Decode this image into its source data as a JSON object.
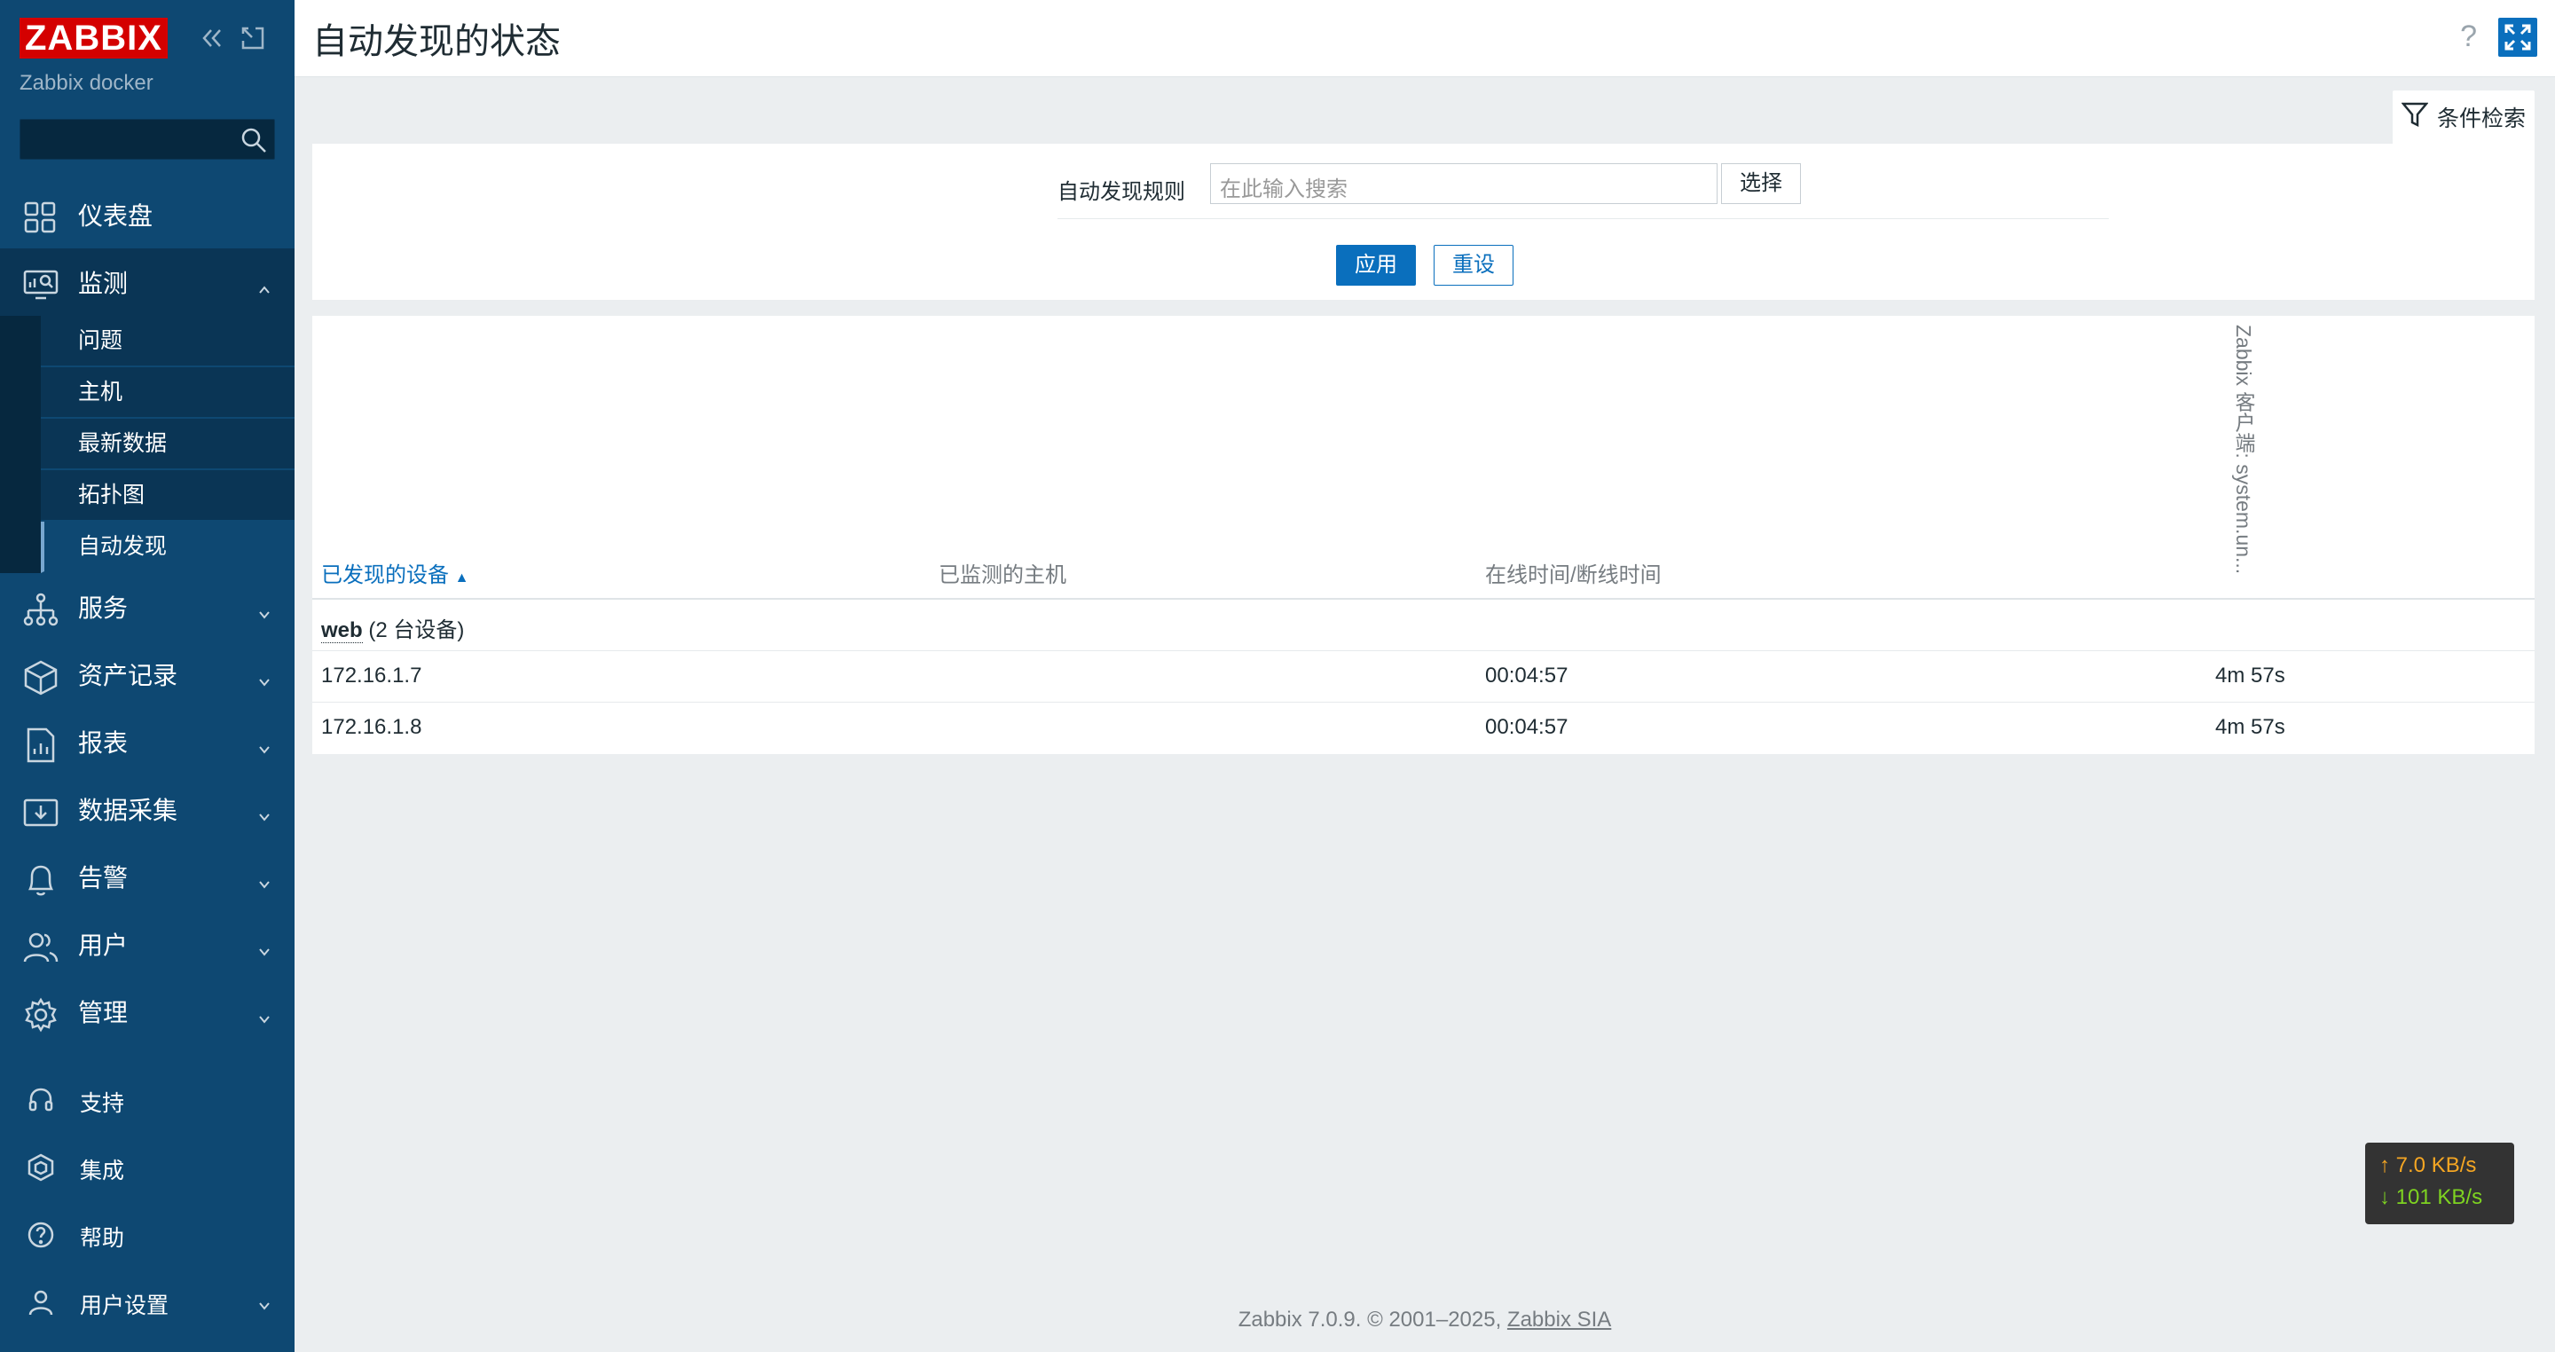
{
  "sidebar": {
    "logo": "ZABBIX",
    "server_name": "Zabbix docker",
    "search_placeholder": "",
    "menu": [
      {
        "label": "仪表盘",
        "icon": "dashboard-icon"
      },
      {
        "label": "监测",
        "icon": "monitoring-icon",
        "expanded": true,
        "children": [
          "问题",
          "主机",
          "最新数据",
          "拓扑图",
          "自动发现"
        ]
      },
      {
        "label": "服务",
        "icon": "services-icon"
      },
      {
        "label": "资产记录",
        "icon": "inventory-icon"
      },
      {
        "label": "报表",
        "icon": "reports-icon"
      },
      {
        "label": "数据采集",
        "icon": "data-collection-icon"
      },
      {
        "label": "告警",
        "icon": "alerts-icon"
      },
      {
        "label": "用户",
        "icon": "users-icon"
      },
      {
        "label": "管理",
        "icon": "administration-icon"
      }
    ],
    "bottom": [
      {
        "label": "支持",
        "icon": "support-icon"
      },
      {
        "label": "集成",
        "icon": "integrations-icon"
      },
      {
        "label": "帮助",
        "icon": "help-icon"
      },
      {
        "label": "用户设置",
        "icon": "user-settings-icon"
      }
    ]
  },
  "header": {
    "title": "自动发现的状态",
    "help": "?"
  },
  "filter": {
    "tab_label": "条件检索",
    "rule_label": "自动发现规则",
    "rule_placeholder": "在此输入搜索",
    "select_label": "选择",
    "apply_label": "应用",
    "reset_label": "重设"
  },
  "table": {
    "headers": {
      "discovered_device": "已发现的设备",
      "monitored_host": "已监测的主机",
      "uptime_downtime": "在线时间/断线时间",
      "check_column": "Zabbix 客户端: system.un..."
    },
    "group": {
      "name": "web",
      "count": "(2 台设备)"
    },
    "rows": [
      {
        "ip": "172.16.1.7",
        "host": "",
        "uptime": "00:04:57",
        "check": "4m 57s"
      },
      {
        "ip": "172.16.1.8",
        "host": "",
        "uptime": "00:04:57",
        "check": "4m 57s"
      }
    ]
  },
  "netspeed": {
    "up": "↑ 7.0 KB/s",
    "down": "↓ 101 KB/s"
  },
  "footer": {
    "text": "Zabbix 7.0.9. © 2001–2025, ",
    "link": "Zabbix SIA"
  },
  "colors": {
    "sidebar": "#0e4872",
    "logo": "#d40000",
    "accent": "#0a6fbd"
  }
}
